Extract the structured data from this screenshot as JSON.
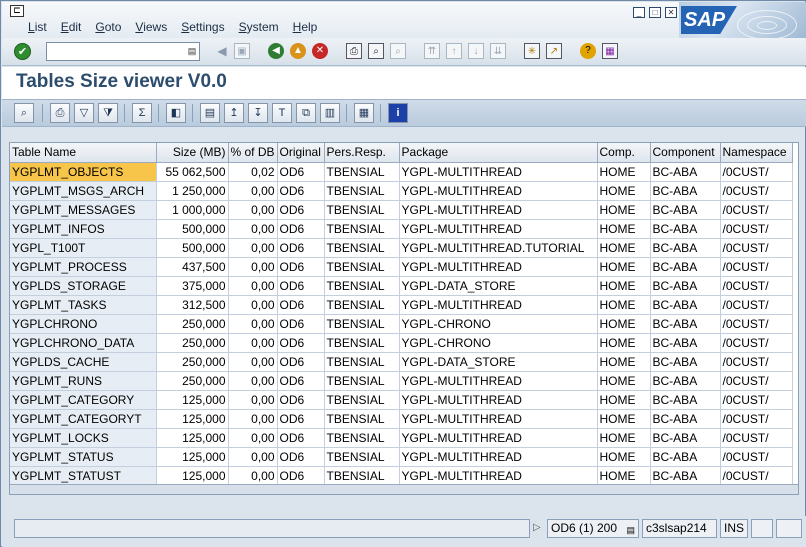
{
  "menu": [
    "List",
    "Edit",
    "Goto",
    "Views",
    "Settings",
    "System",
    "Help"
  ],
  "window_buttons": [
    "minimize",
    "restore",
    "close"
  ],
  "brand": "SAP",
  "command_field": {
    "value": ""
  },
  "title": "Tables Size viewer V0.0",
  "table": {
    "columns": [
      "Table Name",
      "Size (MB)",
      "% of DB",
      "Original",
      "Pers.Resp.",
      "Package",
      "Comp.",
      "Component",
      "Namespace"
    ],
    "rows": [
      [
        "YGPLMT_OBJECTS",
        "55 062,500",
        "0,02",
        "OD6",
        "TBENSIAL",
        "YGPL-MULTITHREAD",
        "HOME",
        "BC-ABA",
        "/0CUST/"
      ],
      [
        "YGPLMT_MSGS_ARCH",
        "1 250,000",
        "0,00",
        "OD6",
        "TBENSIAL",
        "YGPL-MULTITHREAD",
        "HOME",
        "BC-ABA",
        "/0CUST/"
      ],
      [
        "YGPLMT_MESSAGES",
        "1 000,000",
        "0,00",
        "OD6",
        "TBENSIAL",
        "YGPL-MULTITHREAD",
        "HOME",
        "BC-ABA",
        "/0CUST/"
      ],
      [
        "YGPLMT_INFOS",
        "500,000",
        "0,00",
        "OD6",
        "TBENSIAL",
        "YGPL-MULTITHREAD",
        "HOME",
        "BC-ABA",
        "/0CUST/"
      ],
      [
        "YGPL_T100T",
        "500,000",
        "0,00",
        "OD6",
        "TBENSIAL",
        "YGPL-MULTITHREAD.TUTORIAL",
        "HOME",
        "BC-ABA",
        "/0CUST/"
      ],
      [
        "YGPLMT_PROCESS",
        "437,500",
        "0,00",
        "OD6",
        "TBENSIAL",
        "YGPL-MULTITHREAD",
        "HOME",
        "BC-ABA",
        "/0CUST/"
      ],
      [
        "YGPLDS_STORAGE",
        "375,000",
        "0,00",
        "OD6",
        "TBENSIAL",
        "YGPL-DATA_STORE",
        "HOME",
        "BC-ABA",
        "/0CUST/"
      ],
      [
        "YGPLMT_TASKS",
        "312,500",
        "0,00",
        "OD6",
        "TBENSIAL",
        "YGPL-MULTITHREAD",
        "HOME",
        "BC-ABA",
        "/0CUST/"
      ],
      [
        "YGPLCHRONO",
        "250,000",
        "0,00",
        "OD6",
        "TBENSIAL",
        "YGPL-CHRONO",
        "HOME",
        "BC-ABA",
        "/0CUST/"
      ],
      [
        "YGPLCHRONO_DATA",
        "250,000",
        "0,00",
        "OD6",
        "TBENSIAL",
        "YGPL-CHRONO",
        "HOME",
        "BC-ABA",
        "/0CUST/"
      ],
      [
        "YGPLDS_CACHE",
        "250,000",
        "0,00",
        "OD6",
        "TBENSIAL",
        "YGPL-DATA_STORE",
        "HOME",
        "BC-ABA",
        "/0CUST/"
      ],
      [
        "YGPLMT_RUNS",
        "250,000",
        "0,00",
        "OD6",
        "TBENSIAL",
        "YGPL-MULTITHREAD",
        "HOME",
        "BC-ABA",
        "/0CUST/"
      ],
      [
        "YGPLMT_CATEGORY",
        "125,000",
        "0,00",
        "OD6",
        "TBENSIAL",
        "YGPL-MULTITHREAD",
        "HOME",
        "BC-ABA",
        "/0CUST/"
      ],
      [
        "YGPLMT_CATEGORYT",
        "125,000",
        "0,00",
        "OD6",
        "TBENSIAL",
        "YGPL-MULTITHREAD",
        "HOME",
        "BC-ABA",
        "/0CUST/"
      ],
      [
        "YGPLMT_LOCKS",
        "125,000",
        "0,00",
        "OD6",
        "TBENSIAL",
        "YGPL-MULTITHREAD",
        "HOME",
        "BC-ABA",
        "/0CUST/"
      ],
      [
        "YGPLMT_STATUS",
        "125,000",
        "0,00",
        "OD6",
        "TBENSIAL",
        "YGPL-MULTITHREAD",
        "HOME",
        "BC-ABA",
        "/0CUST/"
      ],
      [
        "YGPLMT_STATUST",
        "125,000",
        "0,00",
        "OD6",
        "TBENSIAL",
        "YGPL-MULTITHREAD",
        "HOME",
        "BC-ABA",
        "/0CUST/"
      ]
    ],
    "selected_row": 0
  },
  "status": {
    "system": "OD6 (1) 200",
    "server": "c3slsap214",
    "mode": "INS"
  },
  "colors": {
    "selected_cell": "#f7c54a",
    "title_text": "#2d4d6f",
    "key_column": "#e7edf4"
  }
}
